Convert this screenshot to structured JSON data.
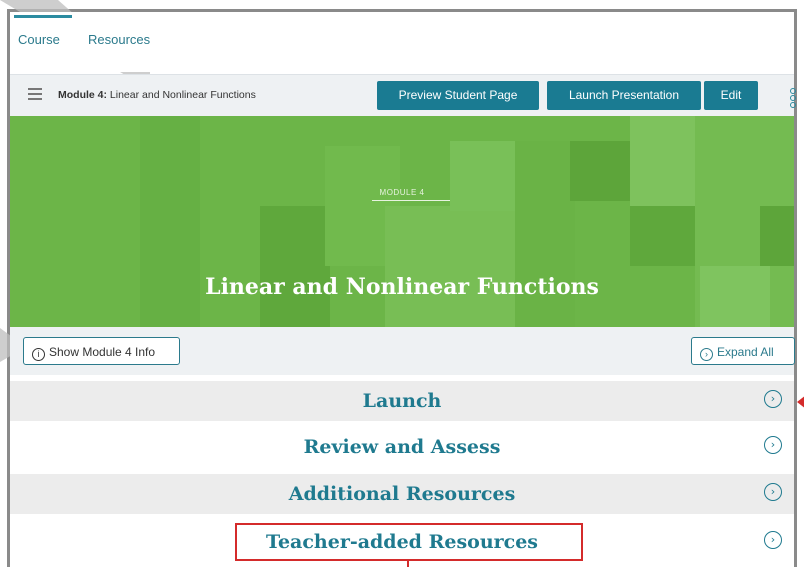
{
  "nav": {
    "tabs": [
      {
        "label": "Course"
      },
      {
        "label": "Resources"
      }
    ]
  },
  "toolbar": {
    "breadcrumb_bold": "Module 4:",
    "breadcrumb_rest": " Linear and Nonlinear Functions",
    "preview_label": "Preview Student Page",
    "launch_presentation_label": "Launch Presentation",
    "edit_label": "Edit"
  },
  "hero": {
    "kicker": "MODULE 4",
    "title": "Linear and Nonlinear Functions"
  },
  "infobar": {
    "show_info_label": "Show Module 4 Info",
    "expand_all_label": "Expand All"
  },
  "sections": [
    {
      "label": "Launch"
    },
    {
      "label": "Review and Assess"
    },
    {
      "label": "Additional Resources"
    },
    {
      "label": "Teacher-added Resources"
    }
  ],
  "colors": {
    "accent": "#1a7b92",
    "hero_green": "#6cb548",
    "highlight_red": "#d42b2b"
  }
}
